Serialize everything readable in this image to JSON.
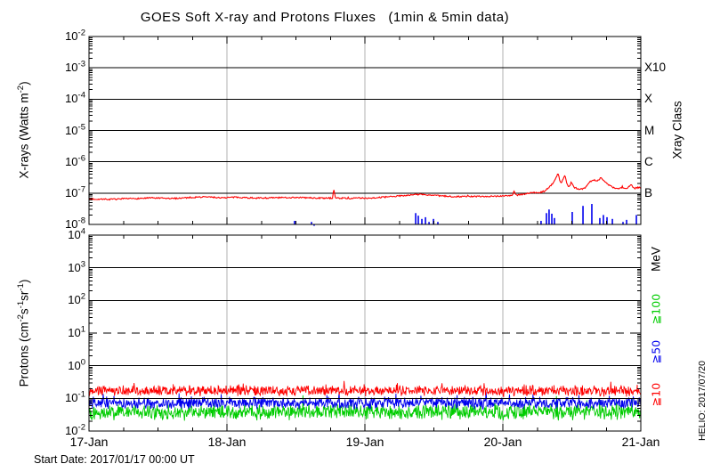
{
  "title": "GOES Soft X-ray and Protons Fluxes   (1min & 5min data)",
  "start_date_note": "Start Date: 2017/01/17 00:00 UT",
  "credit": "HELIO: 2017/07/20",
  "colors": {
    "xray_long": "#ff0000",
    "xray_short": "#0000ee",
    "p10": "#ff0000",
    "p50": "#0000ee",
    "p100": "#00cc00",
    "grid": "#b0b0b0",
    "axis": "#000000"
  },
  "x_axis": {
    "tick_labels": [
      "17-Jan",
      "18-Jan",
      "19-Jan",
      "20-Jan",
      "21-Jan"
    ],
    "minor_ticks_per_day": 4
  },
  "chart_data": [
    {
      "type": "line",
      "panel": "xray",
      "ylabel": {
        "pre": "X-rays (Watts m",
        "sup": "-2",
        "post": ")"
      },
      "right_axis_label": "Xray Class",
      "ylim": [
        1e-08,
        0.01
      ],
      "yticks": [
        {
          "base": "10",
          "exp": "-2"
        },
        {
          "base": "10",
          "exp": "-3"
        },
        {
          "base": "10",
          "exp": "-4"
        },
        {
          "base": "10",
          "exp": "-5"
        },
        {
          "base": "10",
          "exp": "-6"
        },
        {
          "base": "10",
          "exp": "-7"
        },
        {
          "base": "10",
          "exp": "-8"
        }
      ],
      "class_labels": [
        {
          "label": "X10",
          "flux": 0.001
        },
        {
          "label": "X",
          "flux": 0.0001
        },
        {
          "label": "M",
          "flux": 1e-05
        },
        {
          "label": "C",
          "flux": 1e-06
        },
        {
          "label": "B",
          "flux": 1e-07
        }
      ],
      "solid_hlines": [
        0.001,
        0.0001,
        1e-05,
        1e-06,
        1e-07
      ],
      "series": [
        {
          "name": "xray-long",
          "color_key": "xray_long",
          "noise_log": 0.022,
          "keypoints": [
            [
              0.0,
              6.5e-08
            ],
            [
              0.15,
              6.3e-08
            ],
            [
              0.3,
              6.6e-08
            ],
            [
              0.45,
              7e-08
            ],
            [
              0.6,
              6.7e-08
            ],
            [
              0.72,
              7.2e-08
            ],
            [
              0.85,
              7.6e-08
            ],
            [
              0.95,
              7.1e-08
            ],
            [
              1.08,
              7.4e-08
            ],
            [
              1.2,
              6.9e-08
            ],
            [
              1.35,
              7.1e-08
            ],
            [
              1.5,
              7.3e-08
            ],
            [
              1.62,
              7e-08
            ],
            [
              1.72,
              6.9e-08
            ],
            [
              1.765,
              7e-08
            ],
            [
              1.775,
              1.35e-07
            ],
            [
              1.785,
              7e-08
            ],
            [
              1.9,
              6.8e-08
            ],
            [
              2.05,
              7e-08
            ],
            [
              2.18,
              7.6e-08
            ],
            [
              2.31,
              8.6e-08
            ],
            [
              2.4,
              9.2e-08
            ],
            [
              2.5,
              8.4e-08
            ],
            [
              2.62,
              7.8e-08
            ],
            [
              2.8,
              7.8e-08
            ],
            [
              2.95,
              8e-08
            ],
            [
              3.07,
              8.4e-08
            ],
            [
              3.08,
              1.15e-07
            ],
            [
              3.1,
              8.6e-08
            ],
            [
              3.17,
              9.6e-08
            ],
            [
              3.22,
              1.05e-07
            ],
            [
              3.26,
              1e-07
            ],
            [
              3.3,
              1.15e-07
            ],
            [
              3.34,
              1.6e-07
            ],
            [
              3.37,
              2.3e-07
            ],
            [
              3.4,
              4.2e-07
            ],
            [
              3.42,
              2e-07
            ],
            [
              3.435,
              2.7e-07
            ],
            [
              3.45,
              3.8e-07
            ],
            [
              3.465,
              1.9e-07
            ],
            [
              3.48,
              1.6e-07
            ],
            [
              3.5,
              2.2e-07
            ],
            [
              3.52,
              1.5e-07
            ],
            [
              3.56,
              1.3e-07
            ],
            [
              3.6,
              1.5e-07
            ],
            [
              3.63,
              2.3e-07
            ],
            [
              3.66,
              2.6e-07
            ],
            [
              3.69,
              2.5e-07
            ],
            [
              3.71,
              3.1e-07
            ],
            [
              3.74,
              2.3e-07
            ],
            [
              3.77,
              1.8e-07
            ],
            [
              3.8,
              1.5e-07
            ],
            [
              3.84,
              1.4e-07
            ],
            [
              3.87,
              1.5e-07
            ],
            [
              3.9,
              1.35e-07
            ],
            [
              3.93,
              1.95e-07
            ],
            [
              3.95,
              1.4e-07
            ],
            [
              3.98,
              1.5e-07
            ],
            [
              4.0,
              1.55e-07
            ]
          ]
        },
        {
          "name": "xray-short",
          "color_key": "xray_short",
          "spikes": [
            [
              1.49,
              1.3e-08
            ],
            [
              1.594,
              1e-08
            ],
            [
              1.613,
              1.2e-08
            ],
            [
              1.632,
              9e-09
            ],
            [
              2.368,
              2.3e-08
            ],
            [
              2.387,
              1.9e-08
            ],
            [
              2.413,
              1.5e-08
            ],
            [
              2.439,
              1.7e-08
            ],
            [
              2.465,
              1.2e-08
            ],
            [
              2.497,
              1.5e-08
            ],
            [
              2.529,
              1.2e-08
            ],
            [
              2.561,
              1e-08
            ],
            [
              2.6,
              1e-08
            ],
            [
              3.277,
              1.3e-08
            ],
            [
              3.316,
              2.3e-08
            ],
            [
              3.335,
              3e-08
            ],
            [
              3.355,
              2.2e-08
            ],
            [
              3.374,
              1.6e-08
            ],
            [
              3.503,
              2.5e-08
            ],
            [
              3.581,
              3.9e-08
            ],
            [
              3.645,
              4.5e-08
            ],
            [
              3.703,
              1.6e-08
            ],
            [
              3.729,
              2e-08
            ],
            [
              3.755,
              1.7e-08
            ],
            [
              3.794,
              1.5e-08
            ],
            [
              3.871,
              1.2e-08
            ],
            [
              3.897,
              1.4e-08
            ],
            [
              3.968,
              2e-08
            ]
          ]
        }
      ]
    },
    {
      "type": "line",
      "panel": "protons",
      "ylabel_parts": [
        {
          "t": "Protons (cm"
        },
        {
          "s": "-2"
        },
        {
          "t": "s"
        },
        {
          "s": "-1"
        },
        {
          "t": "sr"
        },
        {
          "s": "-1"
        },
        {
          "t": ")"
        }
      ],
      "right_axis_label": "MeV",
      "ylim": [
        0.01,
        10000.0
      ],
      "yticks": [
        {
          "base": "10",
          "exp": "4"
        },
        {
          "base": "10",
          "exp": "3"
        },
        {
          "base": "10",
          "exp": "2"
        },
        {
          "base": "10",
          "exp": "1"
        },
        {
          "base": "10",
          "exp": "0"
        },
        {
          "base": "10",
          "exp": "-1"
        },
        {
          "base": "10",
          "exp": "-2"
        }
      ],
      "solid_hlines": [
        1000.0,
        100.0,
        1.0,
        0.1
      ],
      "dashed_hline": 10.0,
      "energy_labels": [
        {
          "label": "≧100",
          "color_key": "p100"
        },
        {
          "label": "≧50",
          "color_key": "p50"
        },
        {
          "label": "≧10",
          "color_key": "p10"
        }
      ],
      "series": [
        {
          "name": "protons-ge100",
          "color_key": "p100",
          "level": 0.038,
          "noise_log": 0.155
        },
        {
          "name": "protons-ge50",
          "color_key": "p50",
          "level": 0.072,
          "noise_log": 0.115
        },
        {
          "name": "protons-ge10",
          "color_key": "p10",
          "level": 0.17,
          "noise_log": 0.105
        }
      ]
    }
  ]
}
